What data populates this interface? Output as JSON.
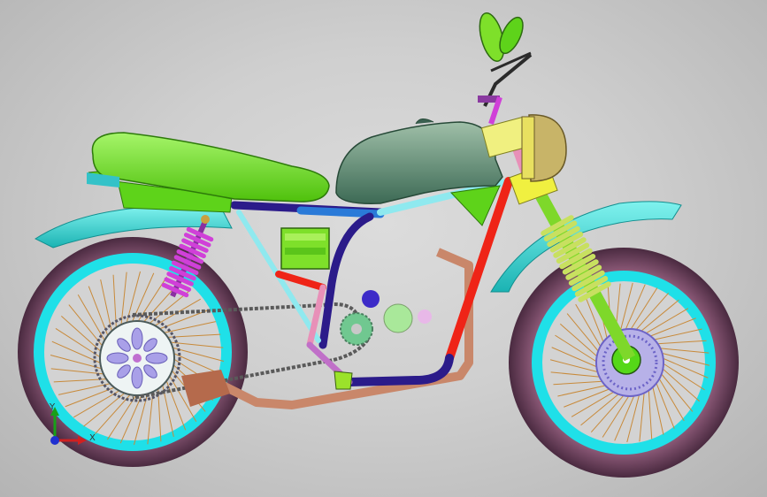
{
  "model": {
    "colors": {
      "background": "#cfcfcf",
      "tire": "#7a4a66",
      "rim": "#19d9e0",
      "spokes": "#c88a3a",
      "fender": "#2fc7c5",
      "seat": "#6fe81f",
      "tank": "#4f7a63",
      "frame_red": "#ef2417",
      "frame_cyan": "#8fe9ef",
      "frame_navy": "#2b1b8a",
      "frame_pink": "#e890b8",
      "exhaust": "#c9876a",
      "spring_magenta": "#d040d8",
      "fork_spring": "#c8e060",
      "headlight": "#c8b468",
      "chain": "#5a5a5a"
    }
  },
  "triad": {
    "x_label": "X",
    "y_label": "Y",
    "z_label": "Z",
    "icon": "coordinate-triad-icon"
  }
}
